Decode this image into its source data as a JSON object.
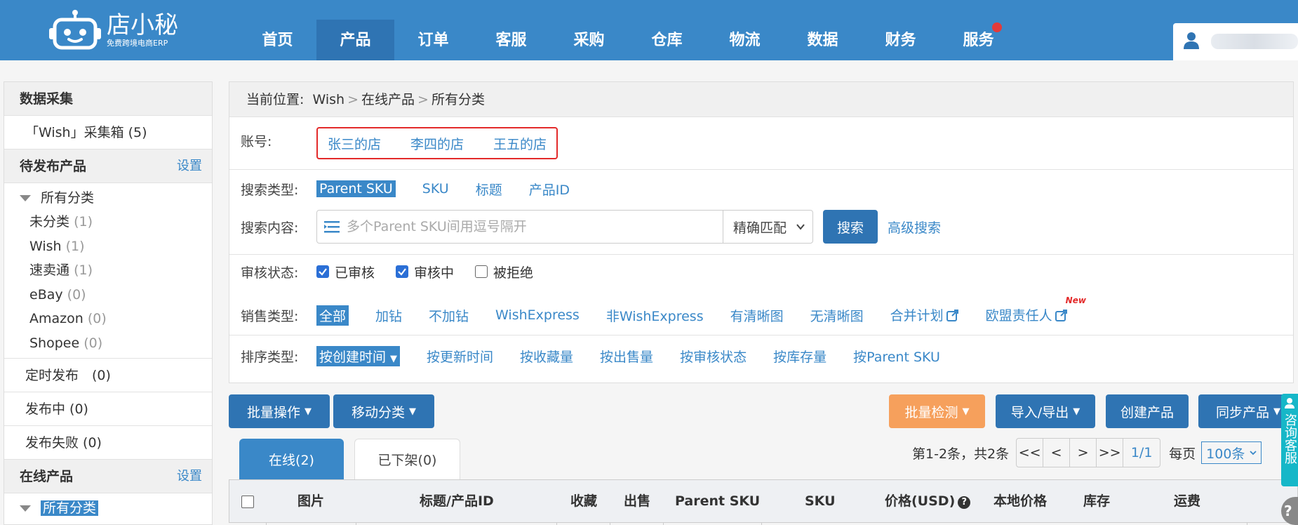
{
  "brand": {
    "name": "店小秘",
    "subtitle": "免费跨境电商ERP"
  },
  "nav": {
    "items": [
      {
        "label": "首页"
      },
      {
        "label": "产品"
      },
      {
        "label": "订单"
      },
      {
        "label": "客服"
      },
      {
        "label": "采购"
      },
      {
        "label": "仓库"
      },
      {
        "label": "物流"
      },
      {
        "label": "数据"
      },
      {
        "label": "财务"
      },
      {
        "label": "服务"
      }
    ],
    "active_index": 1
  },
  "sidebar": {
    "collect_title": "数据采集",
    "collect_box": "「Wish」采集箱 (5)",
    "pending_title": "待发布产品",
    "pending_setting": "设置",
    "pending_tree_root": "所有分类",
    "pending_leaves": [
      {
        "label": "未分类",
        "count": "(1)"
      },
      {
        "label": "Wish",
        "count": "(1)"
      },
      {
        "label": "速卖通",
        "count": "(1)"
      },
      {
        "label": "eBay",
        "count": "(0)"
      },
      {
        "label": "Amazon",
        "count": "(0)"
      },
      {
        "label": "Shopee",
        "count": "(0)"
      }
    ],
    "scheduled": "定时发布　(0)",
    "publishing": "发布中 (0)",
    "failed": "发布失败 (0)",
    "online_title": "在线产品",
    "online_setting": "设置",
    "online_tree_root": "所有分类"
  },
  "breadcrumb": {
    "label": "当前位置:",
    "parts": [
      "Wish",
      "在线产品",
      "所有分类"
    ],
    "sep": ">"
  },
  "filters": {
    "account": {
      "label": "账号:",
      "options": [
        "张三的店",
        "李四的店",
        "王五的店"
      ]
    },
    "search_type": {
      "label": "搜索类型:",
      "options": [
        "Parent SKU",
        "SKU",
        "标题",
        "产品ID"
      ]
    },
    "search_content": {
      "label": "搜索内容:",
      "placeholder": "多个Parent SKU间用逗号隔开",
      "match": "精确匹配",
      "button": "搜索",
      "advanced": "高级搜索"
    },
    "review_status": {
      "label": "审核状态:",
      "options": [
        {
          "label": "已审核",
          "checked": true
        },
        {
          "label": "审核中",
          "checked": true
        },
        {
          "label": "被拒绝",
          "checked": false
        }
      ]
    },
    "sales_type": {
      "label": "销售类型:",
      "options": [
        "全部",
        "加钻",
        "不加钻",
        "WishExpress",
        "非WishExpress",
        "有清晰图",
        "无清晰图",
        "合并计划",
        "欧盟责任人"
      ],
      "new_tag": "New"
    },
    "sort_type": {
      "label": "排序类型:",
      "options": [
        "按创建时间",
        "按更新时间",
        "按收藏量",
        "按出售量",
        "按审核状态",
        "按库存量",
        "按Parent SKU"
      ]
    }
  },
  "toolbar": {
    "batch_ops": "批量操作",
    "move_category": "移动分类",
    "batch_check": "批量检测",
    "import_export": "导入/导出",
    "create_product": "创建产品",
    "sync_product": "同步产品"
  },
  "tabs": {
    "online": "在线(2)",
    "offline": "已下架(0)"
  },
  "pagination": {
    "summary": "第1-2条，共2条",
    "first": "<<",
    "prev": "<",
    "next": ">",
    "last": ">>",
    "page": "1/1",
    "per_page_label": "每页",
    "per_page": "100条"
  },
  "table": {
    "columns": [
      "图片",
      "标题/产品ID",
      "收藏",
      "出售",
      "Parent SKU",
      "SKU",
      "价格(USD)",
      "本地价格",
      "库存",
      "运费"
    ]
  },
  "float": {
    "cs_label": "咨询客服",
    "help": "?"
  },
  "colors": {
    "header_blue": "#3a88c8",
    "active_blue": "#2f74b3",
    "accent_orange": "#f6a05c",
    "alert_red": "#e32a2a",
    "cs_teal": "#16b7c8"
  }
}
